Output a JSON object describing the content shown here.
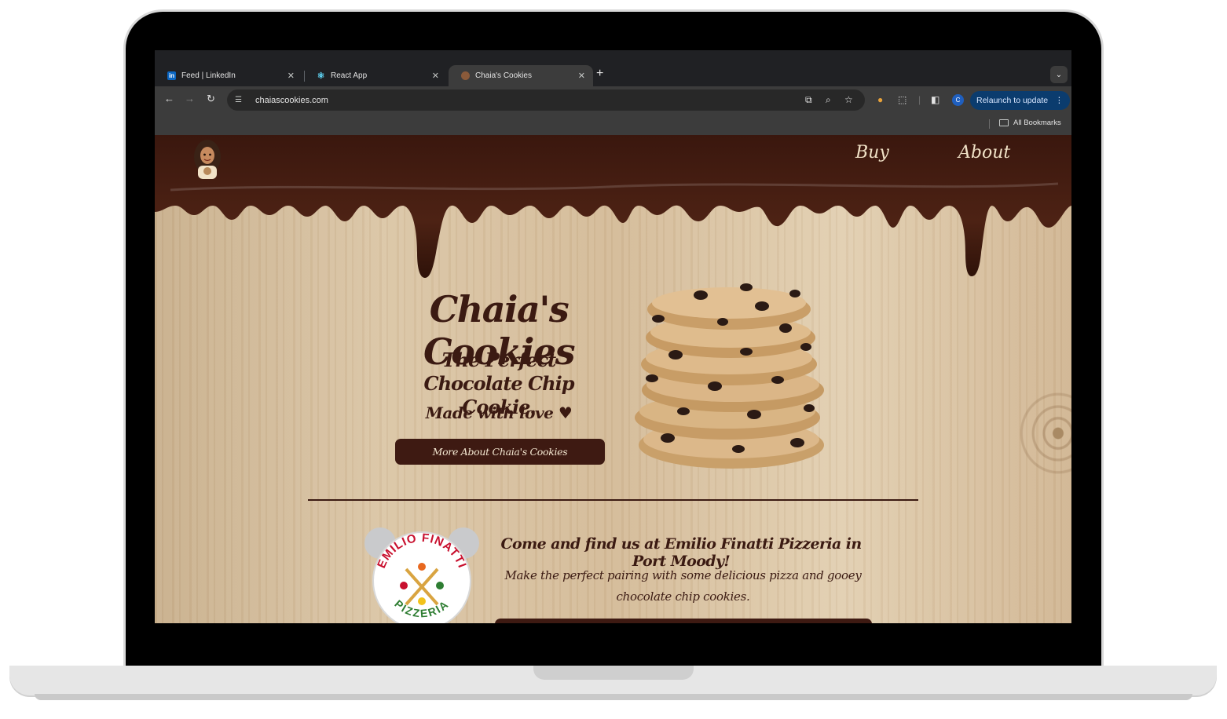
{
  "browser": {
    "tabs": [
      {
        "label": "Feed | LinkedIn",
        "favicon": "linkedin-icon"
      },
      {
        "label": "React App",
        "favicon": "react-icon"
      },
      {
        "label": "Chaia's Cookies",
        "favicon": "avatar-icon",
        "active": true
      }
    ],
    "new_tab_symbol": "+",
    "address": "chaiascookies.com",
    "profile_initial": "C",
    "relaunch_label": "Relaunch to update",
    "bookmarks_label": "All Bookmarks"
  },
  "site": {
    "nav": {
      "buy": "Buy",
      "about": "About"
    },
    "hero": {
      "title": "Chaia's Cookies",
      "subtitle": "The Perfect Chocolate Chip Cookie.",
      "tagline": "Made with love",
      "cta_label": "More About Chaia's Cookies"
    },
    "location": {
      "logo_text_top": "EMILIO FINATTI",
      "logo_text_bottom": "PIZZERIA",
      "title": "Come and find us at Emilio Finatti Pizzeria in Port Moody!",
      "body": "Make the perfect pairing with some delicious pizza and gooey chocolate chip cookies."
    },
    "colors": {
      "chocolate": "#3e1a12",
      "wood": "#d4bb98",
      "nav_text": "#f1e2c7"
    }
  }
}
